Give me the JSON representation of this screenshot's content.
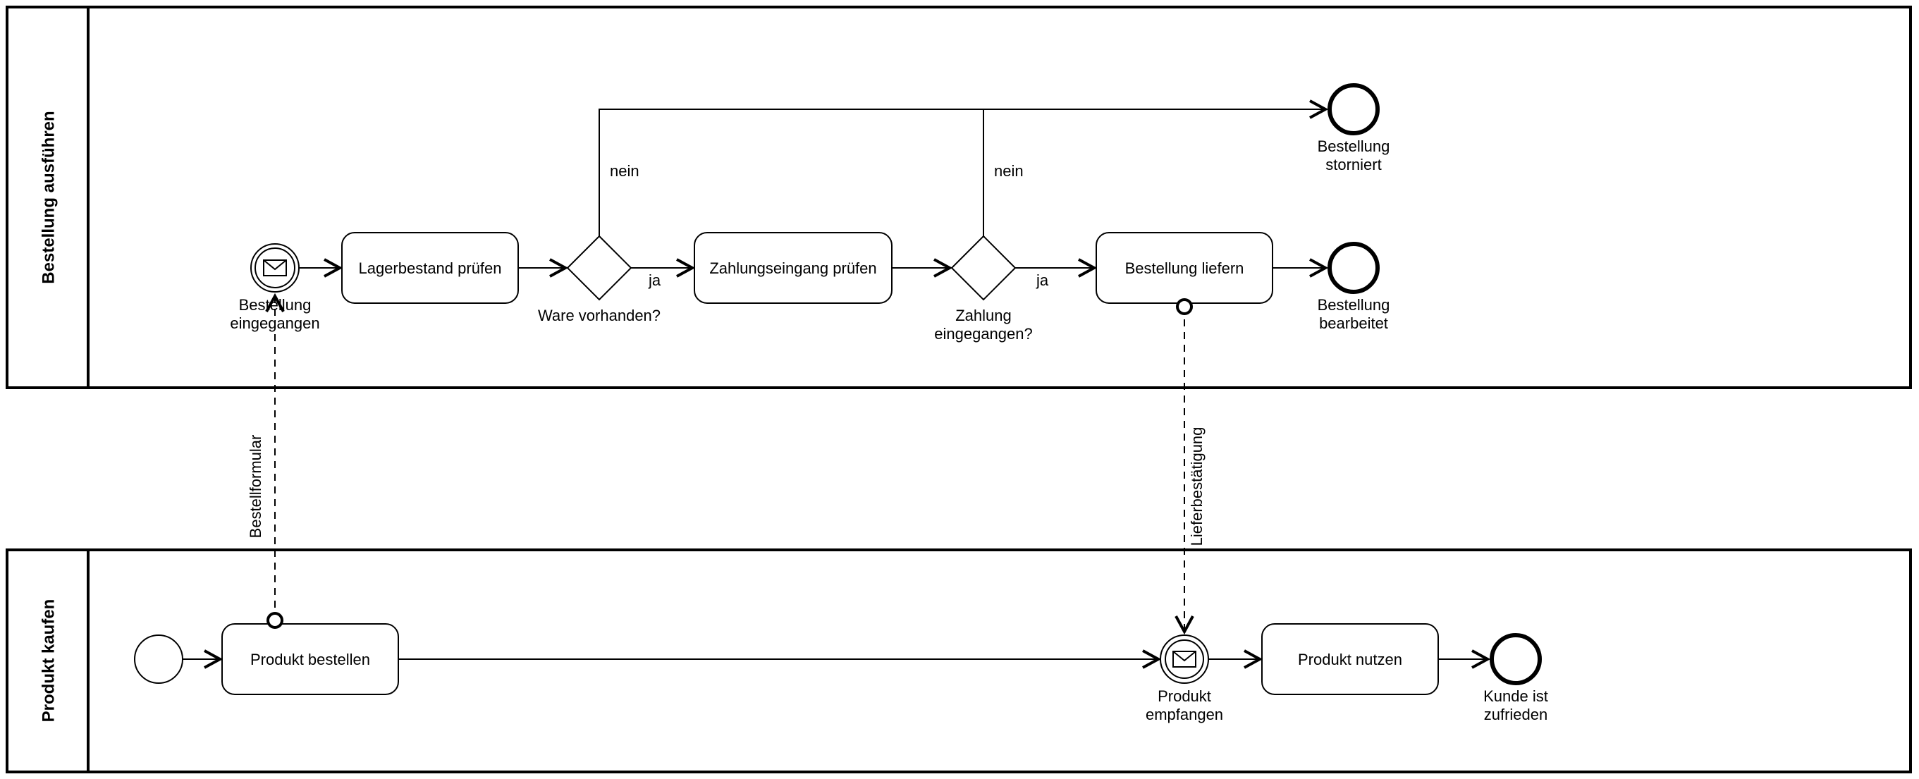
{
  "pools": {
    "top": {
      "title": "Bestellung ausführen"
    },
    "bottom": {
      "title": "Produkt kaufen"
    }
  },
  "events": {
    "orderReceived": {
      "label1": "Bestellung",
      "label2": "eingegangen"
    },
    "orderCancelled": {
      "label1": "Bestellung",
      "label2": "storniert"
    },
    "orderProcessed": {
      "label1": "Bestellung",
      "label2": "bearbeitet"
    },
    "productReceived": {
      "label1": "Produkt",
      "label2": "empfangen"
    },
    "customerHappy": {
      "label1": "Kunde ist",
      "label2": "zufrieden"
    }
  },
  "tasks": {
    "checkStock": {
      "label": "Lagerbestand prüfen"
    },
    "checkPayment": {
      "label": "Zahlungseingang prüfen"
    },
    "deliverOrder": {
      "label": "Bestellung liefern"
    },
    "orderProduct": {
      "label": "Produkt bestellen"
    },
    "useProduct": {
      "label": "Produkt nutzen"
    }
  },
  "gateways": {
    "wareAvailable": {
      "label": "Ware vorhanden?"
    },
    "paymentReceived": {
      "label1": "Zahlung",
      "label2": "eingegangen?"
    }
  },
  "flowLabels": {
    "yes": "ja",
    "no": "nein"
  },
  "messages": {
    "orderForm": {
      "label": "Bestellformular"
    },
    "deliveryConfirm": {
      "label": "Lieferbestätigung"
    }
  }
}
